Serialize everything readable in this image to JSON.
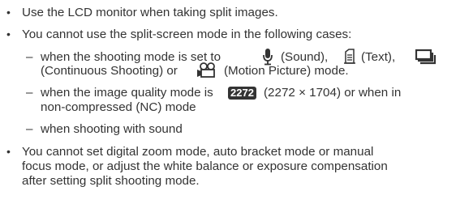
{
  "items": [
    {
      "text": "Use the LCD monitor when taking split images."
    },
    {
      "text": "You cannot use the split-screen mode in the following cases:"
    },
    {
      "sub1_line1_a": "when the shooting mode is set to",
      "sub1_line1_b": "(Sound),",
      "sub1_line1_c": "(Text),",
      "sub1_line2_a": "(Continuous Shooting) or",
      "sub1_line2_b": "(Motion Picture) mode."
    },
    {
      "sub2_line1_a": "when the image quality mode is",
      "sub2_badge": "2272",
      "sub2_line1_b": "(2272 × 1704) or when in",
      "sub2_line2": "non-compressed (NC) mode"
    },
    {
      "sub3": "when shooting with sound"
    },
    {
      "line1": "You cannot set digital zoom mode, auto bracket mode or manual",
      "line2": "focus mode, or adjust the white balance or exposure compensation",
      "line3": "after setting split shooting mode."
    }
  ],
  "bullet": "•",
  "dash": "–",
  "icons": [
    "microphone-icon",
    "text-mode-icon",
    "continuous-shooting-icon",
    "motion-picture-icon"
  ]
}
